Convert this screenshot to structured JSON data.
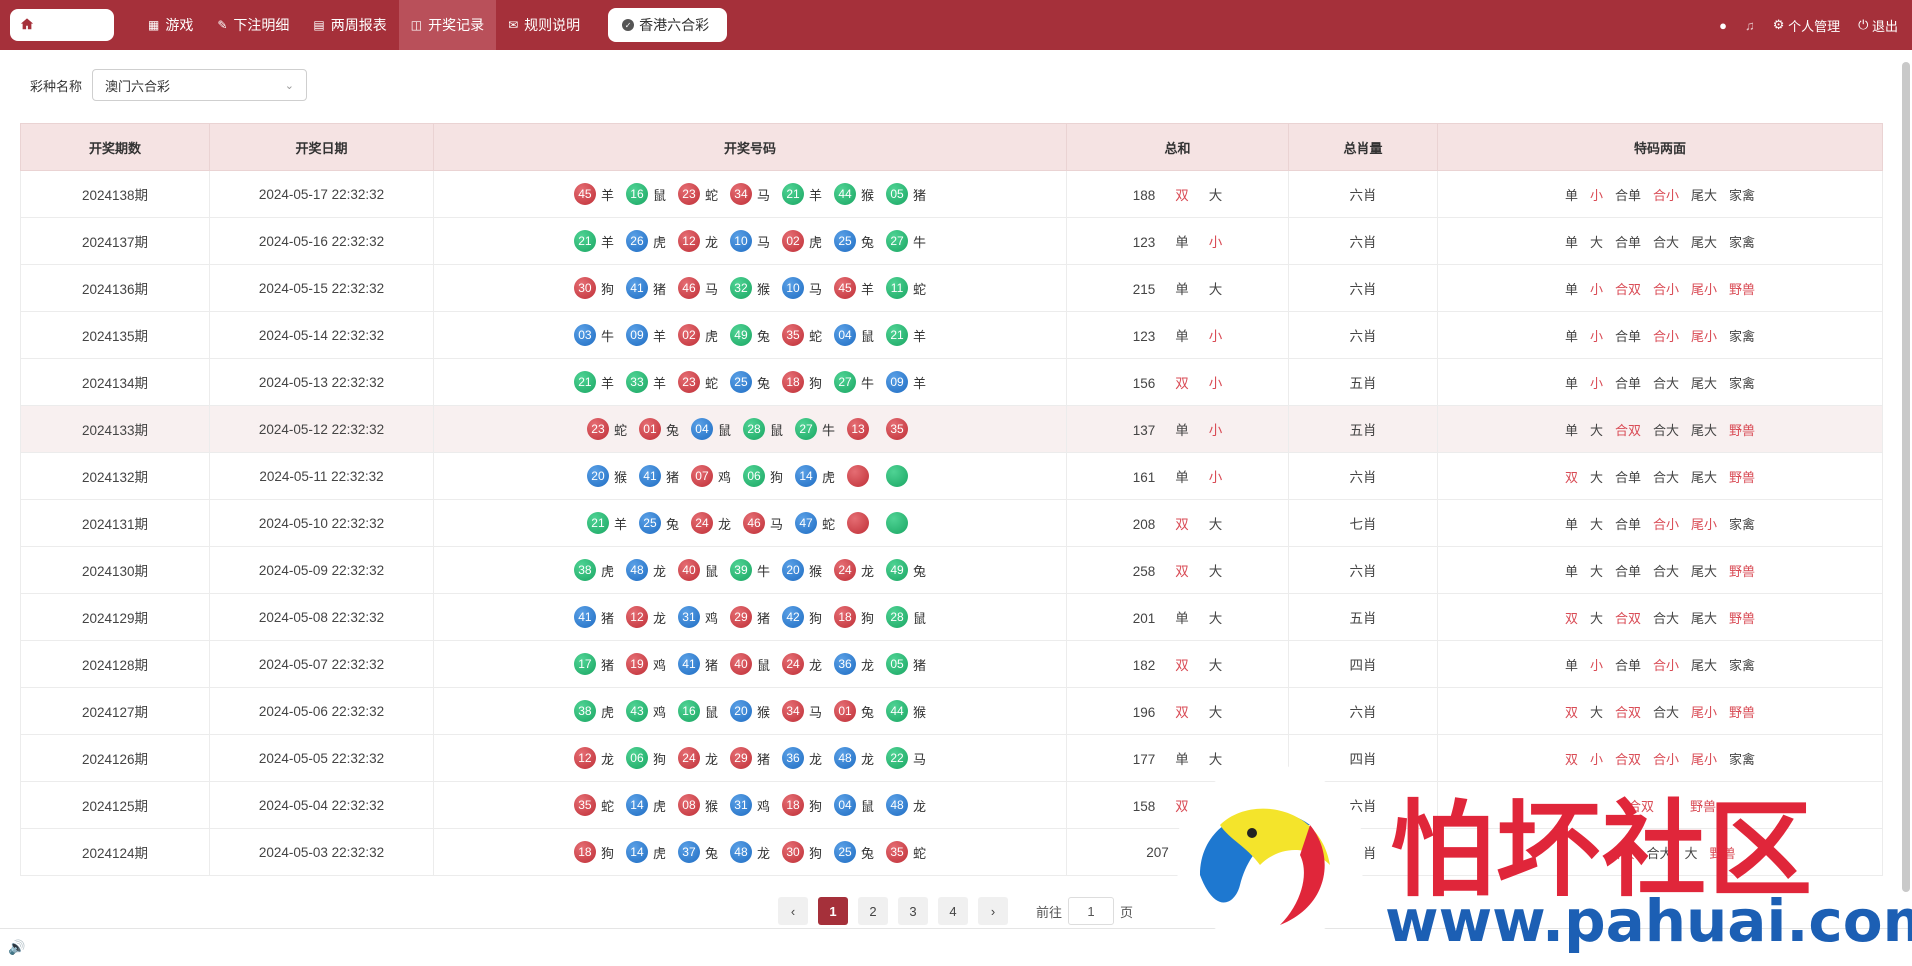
{
  "nav": {
    "items": [
      {
        "icon": "grid-icon",
        "label": "游戏"
      },
      {
        "icon": "edit-icon",
        "label": "下注明细"
      },
      {
        "icon": "calendar-icon",
        "label": "两周报表"
      },
      {
        "icon": "monitor-icon",
        "label": "开奖记录"
      },
      {
        "icon": "message-icon",
        "label": "规则说明"
      }
    ],
    "active_index": 3,
    "lottery_label": "香港六合彩",
    "right": {
      "profile": "个人管理",
      "logout": "退出"
    }
  },
  "filter": {
    "label": "彩种名称",
    "value": "澳门六合彩"
  },
  "table": {
    "headers": [
      "开奖期数",
      "开奖日期",
      "开奖号码",
      "总和",
      "总肖量",
      "特码两面"
    ],
    "rows": [
      {
        "period": "2024138期",
        "date": "2024-05-17 22:32:32",
        "balls": [
          [
            "45",
            "羊",
            "red"
          ],
          [
            "16",
            "鼠",
            "green"
          ],
          [
            "23",
            "蛇",
            "red"
          ],
          [
            "34",
            "马",
            "red"
          ],
          [
            "21",
            "羊",
            "green"
          ],
          [
            "44",
            "猴",
            "green"
          ],
          [
            "05",
            "猪",
            "green"
          ]
        ],
        "sum": "188",
        "sum_oe": "双",
        "sum_size": "大",
        "zodiac_count": "六肖",
        "two": [
          "单",
          "小",
          "合单",
          "合小",
          "尾大",
          "家禽"
        ]
      },
      {
        "period": "2024137期",
        "date": "2024-05-16 22:32:32",
        "balls": [
          [
            "21",
            "羊",
            "green"
          ],
          [
            "26",
            "虎",
            "blue"
          ],
          [
            "12",
            "龙",
            "red"
          ],
          [
            "10",
            "马",
            "blue"
          ],
          [
            "02",
            "虎",
            "red"
          ],
          [
            "25",
            "兔",
            "blue"
          ],
          [
            "27",
            "牛",
            "green"
          ]
        ],
        "sum": "123",
        "sum_oe": "单",
        "sum_size": "小",
        "zodiac_count": "六肖",
        "two": [
          "单",
          "大",
          "合单",
          "合大",
          "尾大",
          "家禽"
        ]
      },
      {
        "period": "2024136期",
        "date": "2024-05-15 22:32:32",
        "balls": [
          [
            "30",
            "狗",
            "red"
          ],
          [
            "41",
            "猪",
            "blue"
          ],
          [
            "46",
            "马",
            "red"
          ],
          [
            "32",
            "猴",
            "green"
          ],
          [
            "10",
            "马",
            "blue"
          ],
          [
            "45",
            "羊",
            "red"
          ],
          [
            "11",
            "蛇",
            "green"
          ]
        ],
        "sum": "215",
        "sum_oe": "单",
        "sum_size": "大",
        "zodiac_count": "六肖",
        "two": [
          "单",
          "小",
          "合双",
          "合小",
          "尾小",
          "野兽"
        ]
      },
      {
        "period": "2024135期",
        "date": "2024-05-14 22:32:32",
        "balls": [
          [
            "03",
            "牛",
            "blue"
          ],
          [
            "09",
            "羊",
            "blue"
          ],
          [
            "02",
            "虎",
            "red"
          ],
          [
            "49",
            "兔",
            "green"
          ],
          [
            "35",
            "蛇",
            "red"
          ],
          [
            "04",
            "鼠",
            "blue"
          ],
          [
            "21",
            "羊",
            "green"
          ]
        ],
        "sum": "123",
        "sum_oe": "单",
        "sum_size": "小",
        "zodiac_count": "六肖",
        "two": [
          "单",
          "小",
          "合单",
          "合小",
          "尾小",
          "家禽"
        ]
      },
      {
        "period": "2024134期",
        "date": "2024-05-13 22:32:32",
        "balls": [
          [
            "21",
            "羊",
            "green"
          ],
          [
            "33",
            "羊",
            "green"
          ],
          [
            "23",
            "蛇",
            "red"
          ],
          [
            "25",
            "兔",
            "blue"
          ],
          [
            "18",
            "狗",
            "red"
          ],
          [
            "27",
            "牛",
            "green"
          ],
          [
            "09",
            "羊",
            "blue"
          ]
        ],
        "sum": "156",
        "sum_oe": "双",
        "sum_size": "小",
        "zodiac_count": "五肖",
        "two": [
          "单",
          "小",
          "合单",
          "合大",
          "尾大",
          "家禽"
        ]
      },
      {
        "period": "2024133期",
        "date": "2024-05-12 22:32:32",
        "balls": [
          [
            "23",
            "蛇",
            "red"
          ],
          [
            "01",
            "兔",
            "red"
          ],
          [
            "04",
            "鼠",
            "blue"
          ],
          [
            "28",
            "鼠",
            "green"
          ],
          [
            "27",
            "牛",
            "green"
          ],
          [
            "13",
            "",
            "red"
          ],
          [
            "35",
            "",
            "red"
          ]
        ],
        "sum": "137",
        "sum_oe": "单",
        "sum_size": "小",
        "zodiac_count": "五肖",
        "two": [
          "单",
          "大",
          "合双",
          "合大",
          "尾大",
          "野兽"
        ]
      },
      {
        "period": "2024132期",
        "date": "2024-05-11 22:32:32",
        "balls": [
          [
            "20",
            "猴",
            "blue"
          ],
          [
            "41",
            "猪",
            "blue"
          ],
          [
            "07",
            "鸡",
            "red"
          ],
          [
            "06",
            "狗",
            "green"
          ],
          [
            "14",
            "虎",
            "blue"
          ],
          [
            "",
            "",
            "red"
          ],
          [
            "",
            "",
            "green"
          ]
        ],
        "sum": "161",
        "sum_oe": "单",
        "sum_size": "小",
        "zodiac_count": "六肖",
        "two": [
          "双",
          "大",
          "合单",
          "合大",
          "尾大",
          "野兽"
        ]
      },
      {
        "period": "2024131期",
        "date": "2024-05-10 22:32:32",
        "balls": [
          [
            "21",
            "羊",
            "green"
          ],
          [
            "25",
            "兔",
            "blue"
          ],
          [
            "24",
            "龙",
            "red"
          ],
          [
            "46",
            "马",
            "red"
          ],
          [
            "47",
            "蛇",
            "blue"
          ],
          [
            "",
            "",
            "red"
          ],
          [
            "",
            "",
            "green"
          ]
        ],
        "sum": "208",
        "sum_oe": "双",
        "sum_size": "大",
        "zodiac_count": "七肖",
        "two": [
          "单",
          "大",
          "合单",
          "合小",
          "尾小",
          "家禽"
        ]
      },
      {
        "period": "2024130期",
        "date": "2024-05-09 22:32:32",
        "balls": [
          [
            "38",
            "虎",
            "green"
          ],
          [
            "48",
            "龙",
            "blue"
          ],
          [
            "40",
            "鼠",
            "red"
          ],
          [
            "39",
            "牛",
            "green"
          ],
          [
            "20",
            "猴",
            "blue"
          ],
          [
            "24",
            "龙",
            "red"
          ],
          [
            "49",
            "兔",
            "green"
          ]
        ],
        "sum": "258",
        "sum_oe": "双",
        "sum_size": "大",
        "zodiac_count": "六肖",
        "two": [
          "单",
          "大",
          "合单",
          "合大",
          "尾大",
          "野兽"
        ]
      },
      {
        "period": "2024129期",
        "date": "2024-05-08 22:32:32",
        "balls": [
          [
            "41",
            "猪",
            "blue"
          ],
          [
            "12",
            "龙",
            "red"
          ],
          [
            "31",
            "鸡",
            "blue"
          ],
          [
            "29",
            "猪",
            "red"
          ],
          [
            "42",
            "狗",
            "blue"
          ],
          [
            "18",
            "狗",
            "red"
          ],
          [
            "28",
            "鼠",
            "green"
          ]
        ],
        "sum": "201",
        "sum_oe": "单",
        "sum_size": "大",
        "zodiac_count": "五肖",
        "two": [
          "双",
          "大",
          "合双",
          "合大",
          "尾大",
          "野兽"
        ]
      },
      {
        "period": "2024128期",
        "date": "2024-05-07 22:32:32",
        "balls": [
          [
            "17",
            "猪",
            "green"
          ],
          [
            "19",
            "鸡",
            "red"
          ],
          [
            "41",
            "猪",
            "blue"
          ],
          [
            "40",
            "鼠",
            "red"
          ],
          [
            "24",
            "龙",
            "red"
          ],
          [
            "36",
            "龙",
            "blue"
          ],
          [
            "05",
            "猪",
            "green"
          ]
        ],
        "sum": "182",
        "sum_oe": "双",
        "sum_size": "大",
        "zodiac_count": "四肖",
        "two": [
          "单",
          "小",
          "合单",
          "合小",
          "尾大",
          "家禽"
        ]
      },
      {
        "period": "2024127期",
        "date": "2024-05-06 22:32:32",
        "balls": [
          [
            "38",
            "虎",
            "green"
          ],
          [
            "43",
            "鸡",
            "green"
          ],
          [
            "16",
            "鼠",
            "green"
          ],
          [
            "20",
            "猴",
            "blue"
          ],
          [
            "34",
            "马",
            "red"
          ],
          [
            "01",
            "兔",
            "red"
          ],
          [
            "44",
            "猴",
            "green"
          ]
        ],
        "sum": "196",
        "sum_oe": "双",
        "sum_size": "大",
        "zodiac_count": "六肖",
        "two": [
          "双",
          "大",
          "合双",
          "合大",
          "尾小",
          "野兽"
        ]
      },
      {
        "period": "2024126期",
        "date": "2024-05-05 22:32:32",
        "balls": [
          [
            "12",
            "龙",
            "red"
          ],
          [
            "06",
            "狗",
            "green"
          ],
          [
            "24",
            "龙",
            "red"
          ],
          [
            "29",
            "猪",
            "red"
          ],
          [
            "36",
            "龙",
            "blue"
          ],
          [
            "48",
            "龙",
            "blue"
          ],
          [
            "22",
            "马",
            "green"
          ]
        ],
        "sum": "177",
        "sum_oe": "单",
        "sum_size": "大",
        "zodiac_count": "四肖",
        "two": [
          "双",
          "小",
          "合双",
          "合小",
          "尾小",
          "家禽"
        ]
      },
      {
        "period": "2024125期",
        "date": "2024-05-04 22:32:32",
        "balls": [
          [
            "35",
            "蛇",
            "red"
          ],
          [
            "14",
            "虎",
            "blue"
          ],
          [
            "08",
            "猴",
            "red"
          ],
          [
            "31",
            "鸡",
            "blue"
          ],
          [
            "18",
            "狗",
            "red"
          ],
          [
            "04",
            "鼠",
            "blue"
          ],
          [
            "48",
            "龙",
            "blue"
          ]
        ],
        "sum": "158",
        "sum_oe": "双",
        "sum_size": "小",
        "zodiac_count": "六肖",
        "two": [
          "",
          "",
          "合双",
          "",
          "",
          "野兽"
        ]
      },
      {
        "period": "2024124期",
        "date": "2024-05-03 22:32:32",
        "balls": [
          [
            "18",
            "狗",
            "red"
          ],
          [
            "14",
            "虎",
            "blue"
          ],
          [
            "37",
            "兔",
            "blue"
          ],
          [
            "48",
            "龙",
            "blue"
          ],
          [
            "30",
            "狗",
            "red"
          ],
          [
            "25",
            "兔",
            "blue"
          ],
          [
            "35",
            "蛇",
            "red"
          ]
        ],
        "sum": "207",
        "sum_oe": "",
        "sum_size": "",
        "zodiac_count": "五肖",
        "two": [
          "",
          "",
          "合双",
          "合大",
          "大",
          "野兽"
        ]
      }
    ],
    "highlight_row": 5
  },
  "pager": {
    "pages": [
      "1",
      "2",
      "3",
      "4"
    ],
    "current": "1",
    "goto_prefix": "前往",
    "goto_value": "1",
    "goto_suffix": "页"
  },
  "watermark": {
    "text": "怕坏社区",
    "url": "www.pahuai.com"
  },
  "colors": {
    "brand": "#a5303a",
    "red_text": "#d94b55",
    "header_bg": "#f5e3e3"
  }
}
